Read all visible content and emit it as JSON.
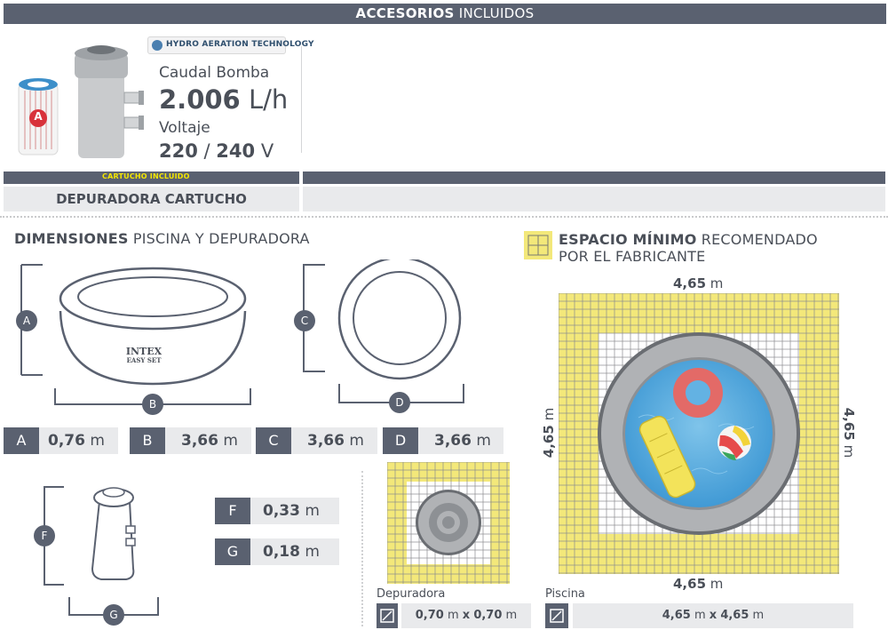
{
  "header": {
    "strong": "ACCESORIOS",
    "rest": " INCLUIDOS"
  },
  "pump": {
    "tech_badge": "HYDRO AERATION TECHNOLOGY",
    "cartridge_letter": "A",
    "flow_label": "Caudal Bomba",
    "flow_value": "2.006",
    "flow_unit": "L/h",
    "voltage_label": "Voltaje",
    "voltage_value_1": "220",
    "voltage_sep": "/",
    "voltage_value_2": "240",
    "voltage_unit": "V"
  },
  "cartridge_bar": {
    "label": "CARTUCHO INCLUIDO"
  },
  "filter_row": {
    "label": "DEPURADORA CARTUCHO"
  },
  "dimensions": {
    "title_strong": "DIMENSIONES",
    "title_rest": " PISCINA Y DEPURADORA",
    "pool_brand": "INTEX",
    "pool_model": "EASY SET",
    "labels": {
      "A": "A",
      "B": "B",
      "C": "C",
      "D": "D",
      "F": "F",
      "G": "G"
    },
    "specs": [
      {
        "letter": "A",
        "value": "0,76",
        "unit": "m"
      },
      {
        "letter": "B",
        "value": "3,66",
        "unit": "m"
      },
      {
        "letter": "C",
        "value": "3,66",
        "unit": "m"
      },
      {
        "letter": "D",
        "value": "3,66",
        "unit": "m"
      }
    ],
    "filter_specs": [
      {
        "letter": "F",
        "value": "0,33",
        "unit": "m"
      },
      {
        "letter": "G",
        "value": "0,18",
        "unit": "m"
      }
    ]
  },
  "space": {
    "title_strong": "ESPACIO MÍNIMO",
    "title_rest": " RECOMENDADO",
    "title_line2": "POR EL FABRICANTE",
    "top_value": "4,65",
    "bottom_value": "4,65",
    "left_value": "4,65",
    "right_value": "4,65",
    "unit": "m",
    "filter_caption": "Depuradora",
    "filter_w": "0,70",
    "filter_h": "0,70",
    "pool_caption": "Piscina",
    "pool_w": "4,65",
    "pool_h": "4,65",
    "times": "x"
  },
  "colors": {
    "dark_slate": "#5a6170",
    "light_gray": "#e9eaec",
    "grid_yellow": "#f3e87a",
    "pool_ring": "#a7a9ac",
    "water": "#4fa7dc",
    "cartridge_yellow": "#f4e600"
  }
}
